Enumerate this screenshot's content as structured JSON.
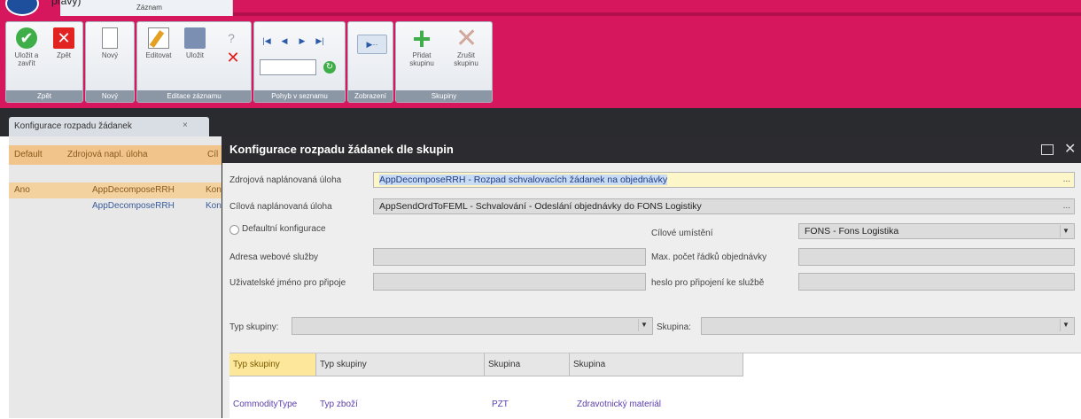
{
  "window": {
    "top_left_text": "pravy)",
    "ribbon_tab": "Záznam"
  },
  "ribbon": {
    "groups": {
      "zpet": "Zpět",
      "novy": "Nový",
      "editace": "Editace záznamu",
      "pohyb": "Pohyb v seznamu",
      "zobrazeni": "Zobrazení",
      "skupiny": "Skupiny"
    },
    "buttons": {
      "ulozit": "Uložit a zavřít",
      "zpet": "Zpět",
      "novy": "Nový",
      "editovat": "Editovat",
      "ulozit2": "Uložit",
      "pridat_skupinu": "Přidat skupinu",
      "zrusit_skupinu": "Zrušit skupinu"
    }
  },
  "doc_tab": {
    "label": "Konfigurace rozpadu žádanek",
    "close": "×"
  },
  "background_grid": {
    "headers": [
      "Default",
      "Zdrojová napl. úloha",
      "Cíl"
    ],
    "rows": [
      [
        "Ano",
        "AppDecomposeRRH",
        "Kon"
      ],
      [
        "",
        "AppDecomposeRRH",
        "Kon"
      ]
    ]
  },
  "dialog": {
    "title": "Konfigurace rozpadu žádanek dle skupin",
    "zdrojova_label": "Zdrojová naplánovaná úloha",
    "zdrojova_value": "AppDecomposeRRH - Rozpad schvalovacích žádanek na objednávky",
    "cilova_label": "Cílová naplánovaná úloha",
    "cilova_value": "AppSendOrdToFEML - Schvalování - Odeslání objednávky do FONS Logistiky",
    "default_label": "Defaultní konfigurace",
    "cilove_umisteni_label": "Cílové umístění",
    "cilove_umisteni_value": "FONS - Fons Logistika",
    "adresa_label": "Adresa webové služby",
    "max_pocet_label": "Max. počet řádků objednávky",
    "uzivatel_label": "Uživatelské jméno pro připoje",
    "heslo_label": "heslo pro připojení ke službě",
    "typ_skupiny_label": "Typ skupiny:",
    "skupina_label": "Skupina:",
    "ellipsis": "...",
    "grid": {
      "headers": [
        "Typ skupiny",
        "Typ skupiny",
        "Skupina",
        "Skupina"
      ],
      "row": [
        "CommodityType",
        "Typ zboží",
        "PZT",
        "Zdravotnický materiál"
      ]
    }
  },
  "colors": {
    "accent": "#d6175e",
    "title_bar": "#2c2c30",
    "highlight": "#fde79a",
    "grid_text": "#5a3fb0"
  },
  "icons": [
    "save-icon",
    "close-icon",
    "new-document-icon",
    "edit-pencil-icon",
    "disk-icon",
    "question-icon",
    "delete-x-icon",
    "first-icon",
    "prev-icon",
    "next-icon",
    "last-icon",
    "refresh-icon",
    "expand-icon",
    "plus-icon",
    "remove-x-icon",
    "dropdown-arrow-icon"
  ]
}
